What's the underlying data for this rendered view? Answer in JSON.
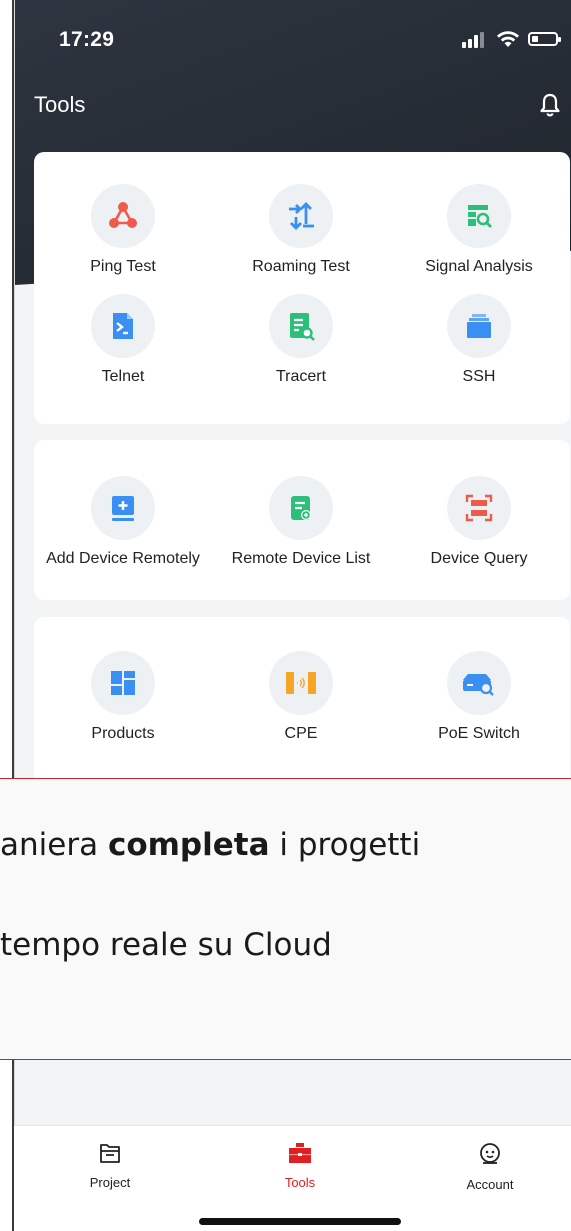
{
  "status": {
    "time": "17:29"
  },
  "header": {
    "title": "Tools"
  },
  "sections": [
    {
      "tools": [
        {
          "label": "Ping Test",
          "icon": "ping-test-icon"
        },
        {
          "label": "Roaming Test",
          "icon": "roaming-test-icon"
        },
        {
          "label": "Signal Analysis",
          "icon": "signal-analysis-icon"
        },
        {
          "label": "Telnet",
          "icon": "telnet-icon"
        },
        {
          "label": "Tracert",
          "icon": "tracert-icon"
        },
        {
          "label": "SSH",
          "icon": "ssh-icon"
        }
      ]
    },
    {
      "tools": [
        {
          "label": "Add Device Remotely",
          "icon": "add-device-icon"
        },
        {
          "label": "Remote Device List",
          "icon": "remote-device-list-icon"
        },
        {
          "label": "Device Query",
          "icon": "device-query-icon"
        }
      ]
    },
    {
      "tools": [
        {
          "label": "Products",
          "icon": "products-icon"
        },
        {
          "label": "CPE",
          "icon": "cpe-icon"
        },
        {
          "label": "PoE Switch",
          "icon": "poe-switch-icon"
        }
      ]
    }
  ],
  "overlay": {
    "line1_pre": "aniera ",
    "line1_bold": "completa",
    "line1_post": " i progetti",
    "line2": "tempo reale su Cloud"
  },
  "tabbar": {
    "tabs": [
      {
        "label": "Project",
        "icon": "folder-icon"
      },
      {
        "label": "Tools",
        "icon": "toolbox-icon"
      },
      {
        "label": "Account",
        "icon": "account-icon"
      }
    ],
    "active": "Tools"
  },
  "colors": {
    "accent": "#e02020",
    "header": "#262c35",
    "blue": "#3b8ff2",
    "green": "#2bbf7a",
    "red": "#f05a4a",
    "orange": "#f5a623"
  }
}
